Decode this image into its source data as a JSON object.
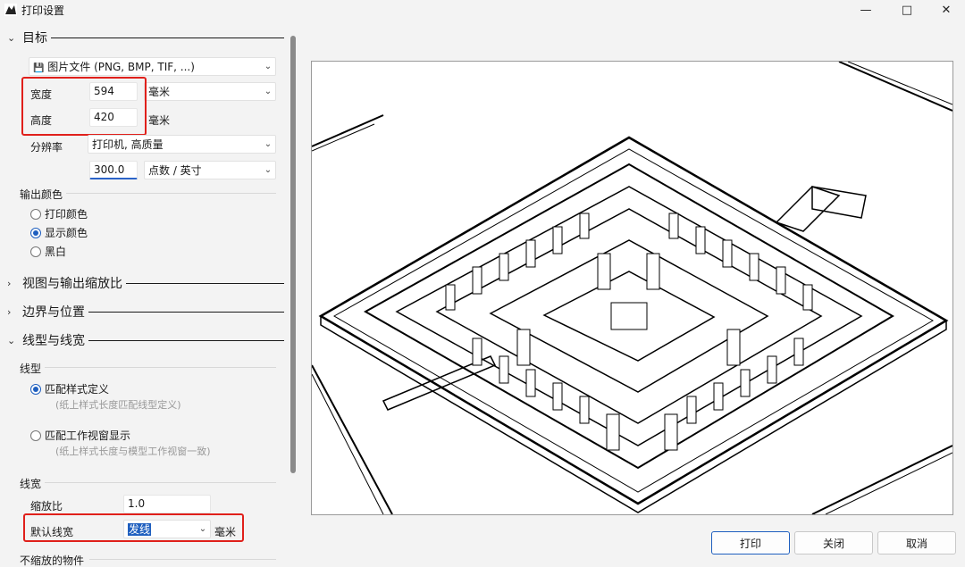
{
  "window": {
    "title": "打印设置"
  },
  "target": {
    "section_label": "目标",
    "device_value": "图片文件 (PNG, BMP, TIF, ...)",
    "width_label": "宽度",
    "width_value": "594",
    "width_unit": "毫米",
    "height_label": "高度",
    "height_value": "420",
    "height_unit": "毫米",
    "resolution_label": "分辨率",
    "resolution_value": "打印机, 高质量",
    "dpi_value": "300.0",
    "dpi_unit": "点数 / 英寸",
    "output_color_label": "输出颜色",
    "color_options": [
      {
        "label": "打印颜色",
        "checked": false
      },
      {
        "label": "显示颜色",
        "checked": true
      },
      {
        "label": "黑白",
        "checked": false
      }
    ]
  },
  "sections": {
    "view_scale": "视图与输出缩放比",
    "margins": "边界与位置",
    "linetype_width": "线型与线宽"
  },
  "linetype": {
    "label": "线型",
    "option1_label": "匹配样式定义",
    "option1_hint": "(纸上样式长度匹配线型定义)",
    "option1_checked": true,
    "option2_label": "匹配工作视窗显示",
    "option2_hint": "(纸上样式长度与模型工作视窗一致)",
    "option2_checked": false
  },
  "lineweight": {
    "label": "线宽",
    "scale_label": "缩放比",
    "scale_value": "1.0",
    "default_label": "默认线宽",
    "default_value": "发线",
    "default_unit": "毫米",
    "unscaled_label": "不缩放的物件"
  },
  "buttons": {
    "print": "打印",
    "close": "关闭",
    "cancel": "取消"
  },
  "colors": {
    "accent": "#1f5fbf",
    "highlight": "#e0201b"
  }
}
